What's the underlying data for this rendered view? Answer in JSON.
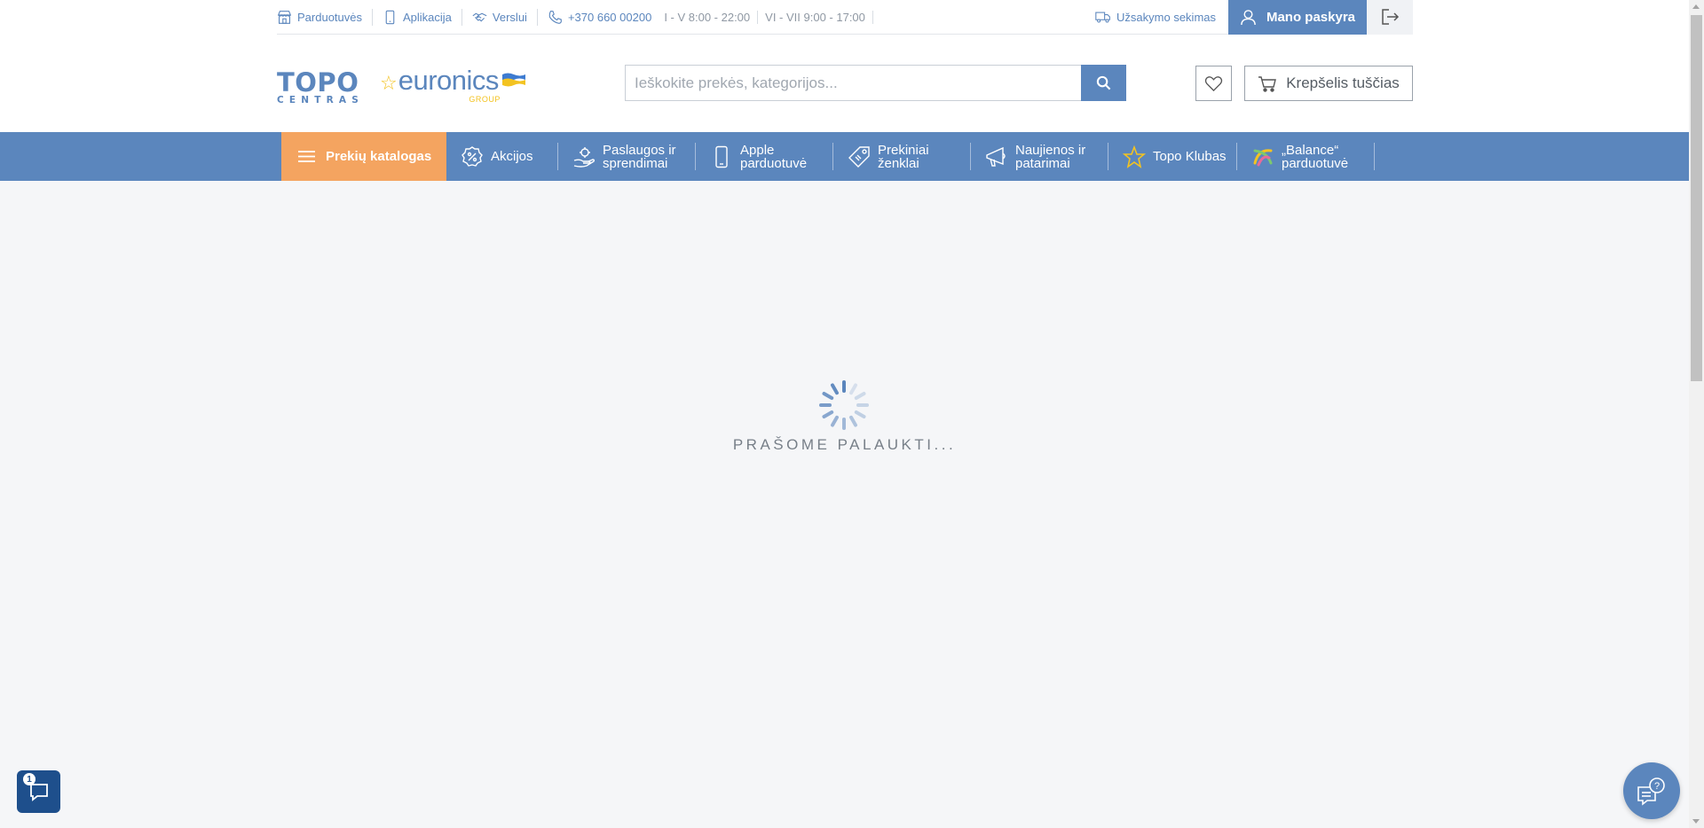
{
  "topbar": {
    "links": [
      {
        "label": "Parduotuvės",
        "icon": "store-icon"
      },
      {
        "label": "Aplikacija",
        "icon": "phone-app-icon"
      },
      {
        "label": "Verslui",
        "icon": "handshake-icon"
      }
    ],
    "phone": "+370 660 00200",
    "hours_weekdays": "I - V 8:00 - 22:00",
    "hours_weekend": "VI - VII 9:00 - 17:00",
    "order_tracking": "Užsakymo sekimas",
    "account_label": "Mano paskyra"
  },
  "logo": {
    "topo_top": "TOPO",
    "topo_bottom": "CENTRAS",
    "euronics": "euronics",
    "group": "GROUP"
  },
  "search": {
    "placeholder": "Ieškokite prekės, kategorijos..."
  },
  "cart": {
    "label": "Krepšelis tuščias"
  },
  "nav": {
    "catalog_label": "Prekių katalogas",
    "items": [
      {
        "label": "Akcijos",
        "icon": "discount-badge-icon"
      },
      {
        "label": "Paslaugos ir sprendimai",
        "icon": "service-hand-icon"
      },
      {
        "label": "Apple parduotuvė",
        "icon": "smartphone-icon"
      },
      {
        "label": "Prekiniai ženklai",
        "icon": "tag-icon"
      },
      {
        "label": "Naujienos ir patarimai",
        "icon": "megaphone-icon"
      },
      {
        "label": "Topo Klubas",
        "icon": "star-icon"
      },
      {
        "label": "„Balance“ parduotuvė",
        "icon": "balance-logo-icon"
      }
    ]
  },
  "loader": {
    "text": "PRAŠOME PALAUKTI..."
  },
  "chat": {
    "badge_count": "1"
  },
  "colors": {
    "brand_blue": "#5b86bd",
    "catalog_orange": "#f4a460",
    "dark_blue": "#1e4f8c",
    "yellow": "#f3c321"
  }
}
